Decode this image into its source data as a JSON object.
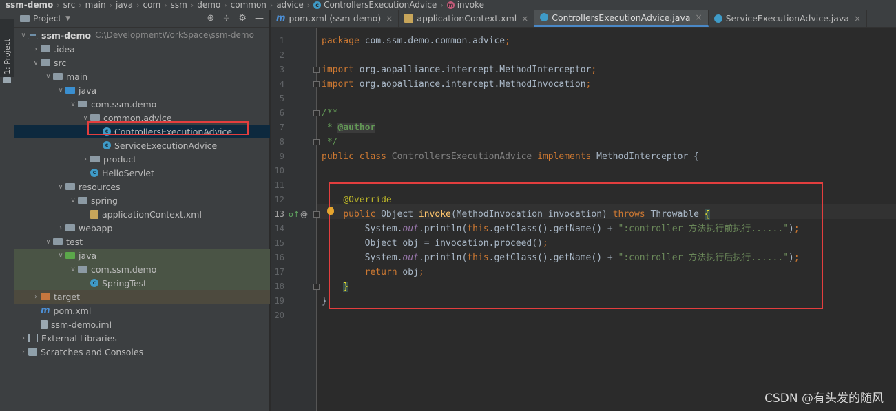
{
  "breadcrumb": [
    {
      "label": "ssm-demo"
    },
    {
      "label": "src"
    },
    {
      "label": "main"
    },
    {
      "label": "java"
    },
    {
      "label": "com"
    },
    {
      "label": "ssm"
    },
    {
      "label": "demo"
    },
    {
      "label": "common"
    },
    {
      "label": "advice"
    },
    {
      "label": "ControllersExecutionAdvice",
      "icon": "class-icon"
    },
    {
      "label": "invoke",
      "icon": "method-icon"
    }
  ],
  "side_strip": {
    "tab_label": "1: Project"
  },
  "project_panel": {
    "title": "Project",
    "tree": [
      {
        "label": "ssm-demo",
        "path": "C:\\DevelopmentWorkSpace\\ssm-demo",
        "depth": 0,
        "chevron": "down",
        "icon": "module",
        "bold": true
      },
      {
        "label": ".idea",
        "depth": 1,
        "chevron": "right",
        "icon": "folder"
      },
      {
        "label": "src",
        "depth": 1,
        "chevron": "down",
        "icon": "folder"
      },
      {
        "label": "main",
        "depth": 2,
        "chevron": "down",
        "icon": "folder"
      },
      {
        "label": "java",
        "depth": 3,
        "chevron": "down",
        "icon": "folder-blue"
      },
      {
        "label": "com.ssm.demo",
        "depth": 4,
        "chevron": "down",
        "icon": "pkg"
      },
      {
        "label": "common.advice",
        "depth": 5,
        "chevron": "down",
        "icon": "pkg"
      },
      {
        "label": "ControllersExecutionAdvice",
        "depth": 6,
        "chevron": "",
        "icon": "class",
        "selected": true
      },
      {
        "label": "ServiceExecutionAdvice",
        "depth": 6,
        "chevron": "",
        "icon": "class"
      },
      {
        "label": "product",
        "depth": 5,
        "chevron": "right",
        "icon": "pkg"
      },
      {
        "label": "HelloServlet",
        "depth": 5,
        "chevron": "",
        "icon": "class"
      },
      {
        "label": "resources",
        "depth": 3,
        "chevron": "down",
        "icon": "folder"
      },
      {
        "label": "spring",
        "depth": 4,
        "chevron": "down",
        "icon": "folder"
      },
      {
        "label": "applicationContext.xml",
        "depth": 5,
        "chevron": "",
        "icon": "xml"
      },
      {
        "label": "webapp",
        "depth": 3,
        "chevron": "right",
        "icon": "folder"
      },
      {
        "label": "test",
        "depth": 2,
        "chevron": "down",
        "icon": "folder"
      },
      {
        "label": "java",
        "depth": 3,
        "chevron": "down",
        "icon": "folder-green",
        "bg": "test-bg"
      },
      {
        "label": "com.ssm.demo",
        "depth": 4,
        "chevron": "down",
        "icon": "pkg",
        "bg": "test-bg"
      },
      {
        "label": "SpringTest",
        "depth": 5,
        "chevron": "",
        "icon": "class",
        "bg": "test-bg"
      },
      {
        "label": "target",
        "depth": 1,
        "chevron": "right",
        "icon": "folder-orange",
        "bg": "target-bg"
      },
      {
        "label": "pom.xml",
        "depth": 1,
        "chevron": "",
        "icon": "maven"
      },
      {
        "label": "ssm-demo.iml",
        "depth": 1,
        "chevron": "",
        "icon": "iml"
      },
      {
        "label": "External Libraries",
        "depth": 0,
        "chevron": "right",
        "icon": "lib"
      },
      {
        "label": "Scratches and Consoles",
        "depth": 0,
        "chevron": "right",
        "icon": "scratch"
      }
    ]
  },
  "tabs": [
    {
      "label": "pom.xml (ssm-demo)",
      "icon": "maven-icon",
      "active": false
    },
    {
      "label": "applicationContext.xml",
      "icon": "xml-file-icon",
      "active": false
    },
    {
      "label": "ControllersExecutionAdvice.java",
      "icon": "class-icon",
      "active": true
    },
    {
      "label": "ServiceExecutionAdvice.java",
      "icon": "class-icon",
      "active": false
    }
  ],
  "editor": {
    "current_line": 13,
    "lines": [
      {
        "n": 1,
        "tokens": [
          [
            "k",
            "package "
          ],
          [
            "",
            "com.ssm.demo.common.advice"
          ],
          [
            "k",
            ";"
          ]
        ]
      },
      {
        "n": 2,
        "tokens": []
      },
      {
        "n": 3,
        "tokens": [
          [
            "k",
            "import "
          ],
          [
            "",
            "org.aopalliance.intercept.MethodInterceptor"
          ],
          [
            "k",
            ";"
          ]
        ]
      },
      {
        "n": 4,
        "tokens": [
          [
            "k",
            "import "
          ],
          [
            "",
            "org.aopalliance.intercept.MethodInvocation"
          ],
          [
            "k",
            ";"
          ]
        ]
      },
      {
        "n": 5,
        "tokens": []
      },
      {
        "n": 6,
        "tokens": [
          [
            "cm",
            "/**"
          ]
        ]
      },
      {
        "n": 7,
        "tokens": [
          [
            "cm",
            " * "
          ],
          [
            "tag",
            "@author"
          ]
        ]
      },
      {
        "n": 8,
        "tokens": [
          [
            "cm",
            " */"
          ]
        ]
      },
      {
        "n": 9,
        "tokens": [
          [
            "k",
            "public class "
          ],
          [
            "gr",
            "ControllersExecutionAdvice "
          ],
          [
            "k",
            "implements "
          ],
          [
            "",
            "MethodInterceptor {"
          ]
        ]
      },
      {
        "n": 10,
        "tokens": []
      },
      {
        "n": 11,
        "tokens": []
      },
      {
        "n": 12,
        "tokens": [
          [
            "",
            "    "
          ],
          [
            "an",
            "@Override"
          ]
        ]
      },
      {
        "n": 13,
        "tokens": [
          [
            "",
            "    "
          ],
          [
            "k",
            "public "
          ],
          [
            "",
            "Object "
          ],
          [
            "fn",
            "invoke"
          ],
          [
            "",
            "(MethodInvocation invocation) "
          ],
          [
            "k",
            "throws "
          ],
          [
            "",
            "Throwable "
          ],
          [
            "bracepair",
            "{"
          ]
        ]
      },
      {
        "n": 14,
        "tokens": [
          [
            "",
            "        System."
          ],
          [
            "fd",
            "out"
          ],
          [
            "",
            ".println("
          ],
          [
            "k",
            "this"
          ],
          [
            "",
            ".getClass().getName() + "
          ],
          [
            "s",
            "\":controller 方法执行前执行......\""
          ],
          [
            "",
            ")"
          ],
          [
            "k",
            ";"
          ]
        ]
      },
      {
        "n": 15,
        "tokens": [
          [
            "",
            "        Object obj = invocation.proceed()"
          ],
          [
            "k",
            ";"
          ]
        ]
      },
      {
        "n": 16,
        "tokens": [
          [
            "",
            "        System."
          ],
          [
            "fd",
            "out"
          ],
          [
            "",
            ".println("
          ],
          [
            "k",
            "this"
          ],
          [
            "",
            ".getClass().getName() + "
          ],
          [
            "s",
            "\":controller 方法执行后执行......\""
          ],
          [
            "",
            ")"
          ],
          [
            "k",
            ";"
          ]
        ]
      },
      {
        "n": 17,
        "tokens": [
          [
            "",
            "        "
          ],
          [
            "k",
            "return "
          ],
          [
            "",
            "obj"
          ],
          [
            "k",
            ";"
          ]
        ]
      },
      {
        "n": 18,
        "tokens": [
          [
            "",
            "    "
          ],
          [
            "bracepair",
            "}"
          ]
        ]
      },
      {
        "n": 19,
        "tokens": [
          [
            "",
            "}"
          ]
        ]
      },
      {
        "n": 20,
        "tokens": []
      }
    ]
  },
  "watermark": "CSDN @有头发的随风",
  "colors": {
    "keyword": "#cc7832",
    "string": "#6a8759",
    "annotation": "#bbb529",
    "method": "#ffc66d",
    "highlight_box": "#e33e3e",
    "selection": "#0d293e"
  }
}
